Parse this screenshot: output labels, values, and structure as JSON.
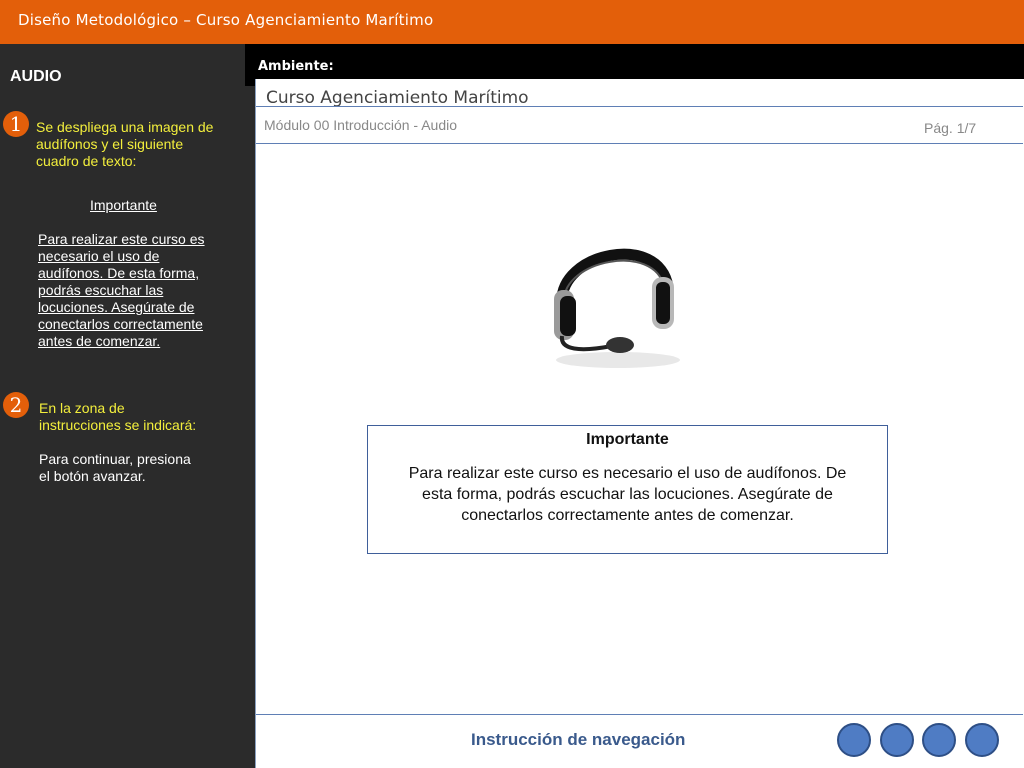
{
  "window": {
    "title": "Diseño  Metodológico – Curso Agenciamiento Marítimo"
  },
  "sidebar": {
    "title": "AUDIO",
    "step1": {
      "number": "1",
      "text_lines": [
        "Se despliega una imagen de",
        "audífonos  y el siguiente",
        "cuadro de texto:"
      ],
      "heading": "Importante",
      "body_lines": [
        "Para realizar este curso es",
        "necesario el uso de",
        "audífonos. De esta forma,",
        "podrás escuchar las",
        "locuciones. Asegúrate de",
        "conectarlos correctamente",
        "antes de comenzar."
      ]
    },
    "step2": {
      "number": "2",
      "text_lines": [
        "En la zona de",
        "instrucciones se indicará:"
      ],
      "body_lines": [
        "Para continuar, presiona",
        "el botón avanzar."
      ]
    }
  },
  "main": {
    "ambiente_label": "Ambiente:",
    "course_title": "Curso Agenciamiento Marítimo",
    "module": "Módulo 00 Introducción - Audio",
    "page": "Pág. 1/7",
    "image_icon": "headphones-icon",
    "notice": {
      "title": "Importante",
      "body_lines": [
        "Para realizar este curso es necesario el uso de audífonos. De",
        "esta forma, podrás escuchar las locuciones. Asegúrate de",
        "conectarlos correctamente antes de comenzar."
      ]
    },
    "nav_instruction": "Instrucción de navegación"
  },
  "colors": {
    "accent": "#e35f0a",
    "nav_button": "#4f7cc4",
    "highlight_text": "#f3ef3c"
  }
}
